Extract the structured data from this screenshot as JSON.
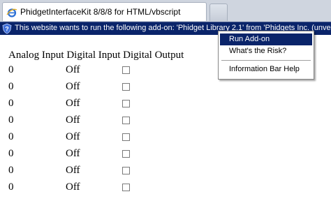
{
  "tab": {
    "title": "PhidgetInterfaceKit 8/8/8 for HTML/vbscript",
    "icon": "ie-page-icon"
  },
  "infobar": {
    "message": "This website wants to run the following add-on: 'Phidget Library 2.1' from 'Phidgets Inc. (unverified"
  },
  "context_menu": {
    "items": [
      {
        "label": "Run Add-on"
      },
      {
        "label": "What's the Risk?"
      },
      {
        "label": "Information Bar Help"
      }
    ]
  },
  "table": {
    "headers": [
      "Analog Input",
      "Digital Input",
      "Digital Output"
    ],
    "rows": [
      {
        "analog": "0",
        "digital": "Off",
        "output_checked": false
      },
      {
        "analog": "0",
        "digital": "Off",
        "output_checked": false
      },
      {
        "analog": "0",
        "digital": "Off",
        "output_checked": false
      },
      {
        "analog": "0",
        "digital": "Off",
        "output_checked": false
      },
      {
        "analog": "0",
        "digital": "Off",
        "output_checked": false
      },
      {
        "analog": "0",
        "digital": "Off",
        "output_checked": false
      },
      {
        "analog": "0",
        "digital": "Off",
        "output_checked": false
      },
      {
        "analog": "0",
        "digital": "Off",
        "output_checked": false
      }
    ]
  },
  "colors": {
    "infobar_bg": "#0a246a",
    "tabbar_bg": "#cfd5df",
    "menu_highlight": "#0a246a"
  }
}
